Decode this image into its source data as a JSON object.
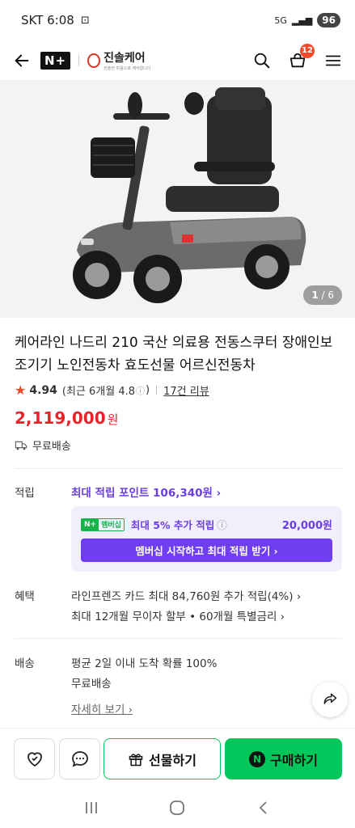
{
  "status_bar": {
    "carrier_time": "SKT 6:08",
    "network": "5G",
    "battery": "96"
  },
  "header": {
    "logo": "N+",
    "store_name": "진솔케어",
    "store_tagline": "진솔한 마음으로 케어합니다",
    "cart_count": "12"
  },
  "image": {
    "counter_current": "1",
    "counter_total": " / 6"
  },
  "product": {
    "title": "케어라인 나드리 210 국산 의료용 전동스쿠터 장애인보조기기 노인전동차 효도선물 어르신전동차",
    "rating": "4.94",
    "rating_recent": "(최근 6개월 4.8",
    "rating_recent_close": ")",
    "review_link": "17건 리뷰",
    "price": "2,119,000",
    "price_unit": "원",
    "shipping": "무료배송"
  },
  "points": {
    "label": "적립",
    "max_points": "최대 적립 포인트 106,340원 ›",
    "badge_n": "N+",
    "badge_text": "멤버십",
    "extra_text": "최대 5% 추가 적립",
    "extra_amount": "20,000원",
    "cta": "멤버십 시작하고 최대 적립 받기 ›"
  },
  "benefits": {
    "label": "혜택",
    "line1": "라인프렌즈 카드 최대 84,760원 추가 적립(4%) ›",
    "line2": "최대 12개월 무이자 할부 • 60개월 특별금리 ›"
  },
  "delivery": {
    "label": "배송",
    "line1": "평균 2일 이내 도착 확률 100%",
    "line2": "무료배송",
    "detail_link": "자세히 보기 ›"
  },
  "bottom_bar": {
    "gift_label": "선물하기",
    "buy_label": "구매하기"
  },
  "colors": {
    "price_red": "#e8242b",
    "accent_purple": "#6a3ee0",
    "naver_green": "#03c75a"
  }
}
